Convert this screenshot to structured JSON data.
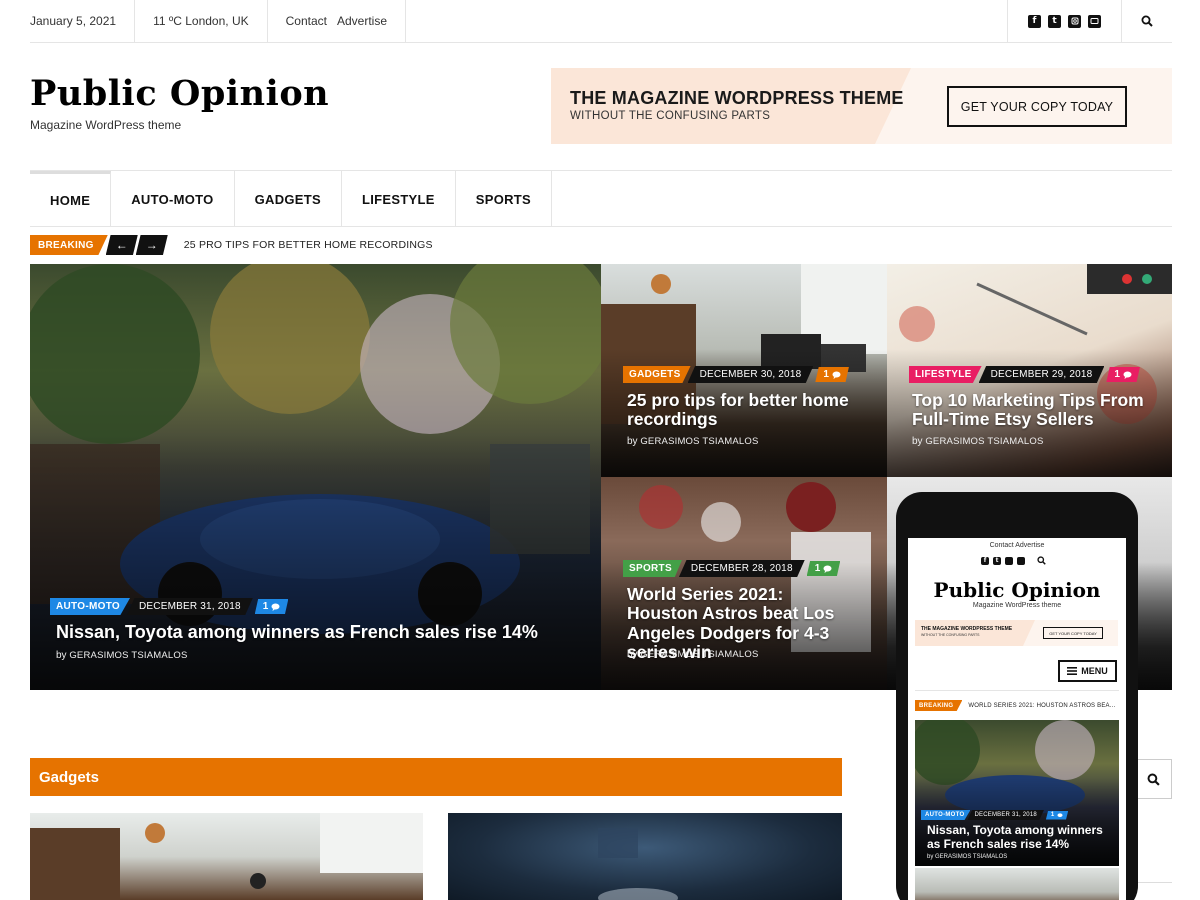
{
  "topbar": {
    "date": "January 5, 2021",
    "weather": "11 ºC London, UK",
    "links": [
      "Contact",
      "Advertise"
    ]
  },
  "site": {
    "logo": "Public Opinion",
    "tagline": "Magazine WordPress theme"
  },
  "banner": {
    "title": "THE MAGAZINE WORDPRESS THEME",
    "subtitle": "WITHOUT THE CONFUSING PARTS",
    "button": "GET YOUR COPY TODAY"
  },
  "nav": [
    "HOME",
    "AUTO-MOTO",
    "GADGETS",
    "LIFESTYLE",
    "SPORTS"
  ],
  "breaking": {
    "label": "BREAKING",
    "prev": "←",
    "next": "→",
    "text": "25 PRO TIPS FOR BETTER HOME RECORDINGS"
  },
  "colors": {
    "accent": "#e67300",
    "auto_moto": "#1e88e5",
    "gadgets": "#e67300",
    "lifestyle": "#e91e63",
    "sports": "#43a047"
  },
  "posts": [
    {
      "category": "AUTO-MOTO",
      "date": "DECEMBER 31, 2018",
      "comments": "1",
      "title": "Nissan, Toyota among winners as French sales rise 14%",
      "by": "by",
      "author": "GERASIMOS TSIAMALOS"
    },
    {
      "category": "GADGETS",
      "date": "DECEMBER 30, 2018",
      "comments": "1",
      "title": "25 pro tips for better home recordings",
      "by": "by",
      "author": "GERASIMOS TSIAMALOS"
    },
    {
      "category": "LIFESTYLE",
      "date": "DECEMBER 29, 2018",
      "comments": "1",
      "title": "Top 10 Marketing Tips From Full-Time Etsy Sellers",
      "by": "by",
      "author": "GERASIMOS TSIAMALOS"
    },
    {
      "category": "SPORTS",
      "date": "DECEMBER 28, 2018",
      "comments": "1",
      "title": "World Series 2021: Houston Astros beat Los Angeles Dodgers for 4-3 series win",
      "by": "by",
      "author": "GERASIMOS TSIAMALOS"
    }
  ],
  "section": {
    "title": "Gadgets"
  },
  "phone": {
    "links": "Contact  Advertise",
    "logo": "Public Opinion",
    "tagline": "Magazine WordPress theme",
    "banner_title": "THE MAGAZINE WORDPRESS THEME",
    "banner_sub": "WITHOUT THE CONFUSING PARTS",
    "banner_btn": "GET YOUR COPY TODAY",
    "menu": "MENU",
    "breaking_label": "BREAKING",
    "breaking_text": "WORLD SERIES 2021: HOUSTON ASTROS BEA...",
    "category": "AUTO-MOTO",
    "date": "DECEMBER 31, 2018",
    "comments": "1",
    "title": "Nissan, Toyota among winners as French sales rise 14%",
    "by": "by",
    "author": "GERASIMOS TSIAMALOS"
  }
}
